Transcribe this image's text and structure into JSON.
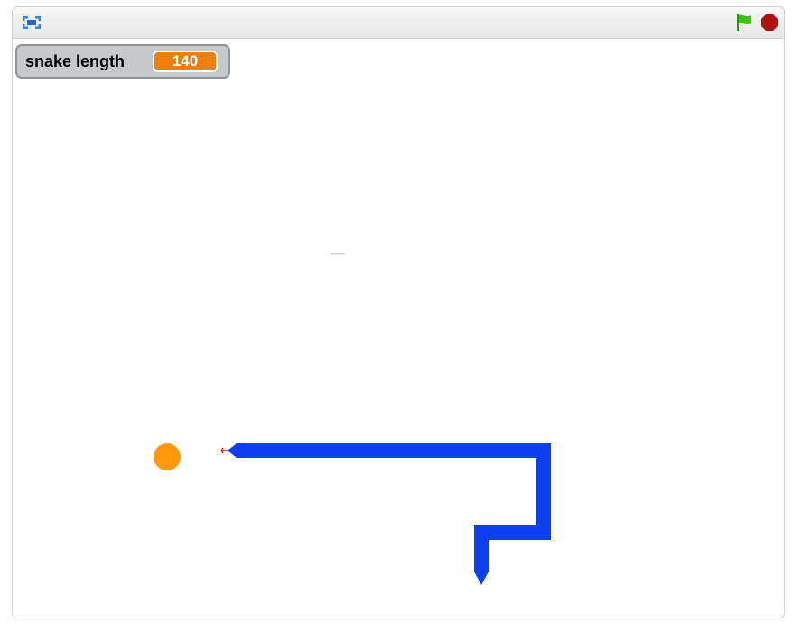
{
  "toolbar": {
    "fullscreen_icon": "fullscreen-toggle-icon",
    "green_flag_icon": "green-flag-icon",
    "stop_icon": "stop-sign-icon",
    "flag_color": "#3ec21b",
    "stop_color": "#b01010"
  },
  "monitor": {
    "label": "snake length",
    "value": "140",
    "value_color": "#f27d0c"
  },
  "sprites": {
    "food_color": "#fd9a0c",
    "snake_color": "#0d3ef0"
  }
}
